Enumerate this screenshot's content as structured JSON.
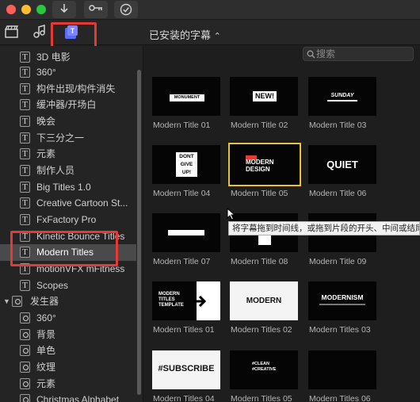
{
  "titlebar": {
    "buttons": [
      "download",
      "keyframe",
      "checkmark"
    ]
  },
  "toolbar": {
    "tabs": [
      "photos-audio-icon",
      "music-icon",
      "titles-generators-icon"
    ],
    "browser_header": "已安装的字幕 ⌃",
    "browser_header_text": "已安装的字幕",
    "search_placeholder": "搜索"
  },
  "sidebar": {
    "items": [
      {
        "label": "3D 电影"
      },
      {
        "label": "360°"
      },
      {
        "label": "构件出现/构件消失"
      },
      {
        "label": "缓冲器/开场白"
      },
      {
        "label": "晚会"
      },
      {
        "label": "下三分之一"
      },
      {
        "label": "元素"
      },
      {
        "label": "制作人员"
      },
      {
        "label": "Big Titles 1.0"
      },
      {
        "label": "Creative Cartoon St..."
      },
      {
        "label": "FxFactory Pro"
      },
      {
        "label": "Kinetic Bounce Titles"
      },
      {
        "label": "Modern Titles"
      },
      {
        "label": "motionVFX mFitness"
      },
      {
        "label": "Scopes"
      }
    ],
    "generator_group": "发生器",
    "generator_items": [
      {
        "label": "360°"
      },
      {
        "label": "背景"
      },
      {
        "label": "单色"
      },
      {
        "label": "纹理"
      },
      {
        "label": "元素"
      },
      {
        "label": "Christmas Alphabet"
      }
    ],
    "selected": "Modern Titles"
  },
  "grid": {
    "items": [
      {
        "label": "Modern Title 01",
        "text": "MONUMENT"
      },
      {
        "label": "Modern Title 02",
        "text": "NEW!"
      },
      {
        "label": "Modern Title 03",
        "text": "SUNDAY"
      },
      {
        "label": "Modern Title 04",
        "text": "DONT GIVE UP!"
      },
      {
        "label": "Modern Title 05",
        "text": "MODERN DESIGN"
      },
      {
        "label": "Modern Title 06",
        "text": "QUIET"
      },
      {
        "label": "Modern Title 07",
        "text": ""
      },
      {
        "label": "Modern Title 08",
        "text": ""
      },
      {
        "label": "Modern Title 09",
        "text": ""
      },
      {
        "label": "Modern Titles 01",
        "text": "MODERN TITLES TEMPLATE"
      },
      {
        "label": "Modern Titles 02",
        "text": "MODERN"
      },
      {
        "label": "Modern Titles 03",
        "text": "MODERNISM"
      },
      {
        "label": "Modern Titles 04",
        "text": "#SUBSCRIBE"
      },
      {
        "label": "Modern Titles 05",
        "text": "#CLEAN #CREATIVE"
      },
      {
        "label": "Modern Titles 06",
        "text": ""
      }
    ],
    "selected": "Modern Title 05"
  },
  "tooltip": "将字幕拖到时间线，或拖到片段的开头、中间或结尾",
  "colors": {
    "highlight_red": "#e53935",
    "selection_yellow": "#e8c33a",
    "window_bg": "#1f1f1f"
  }
}
